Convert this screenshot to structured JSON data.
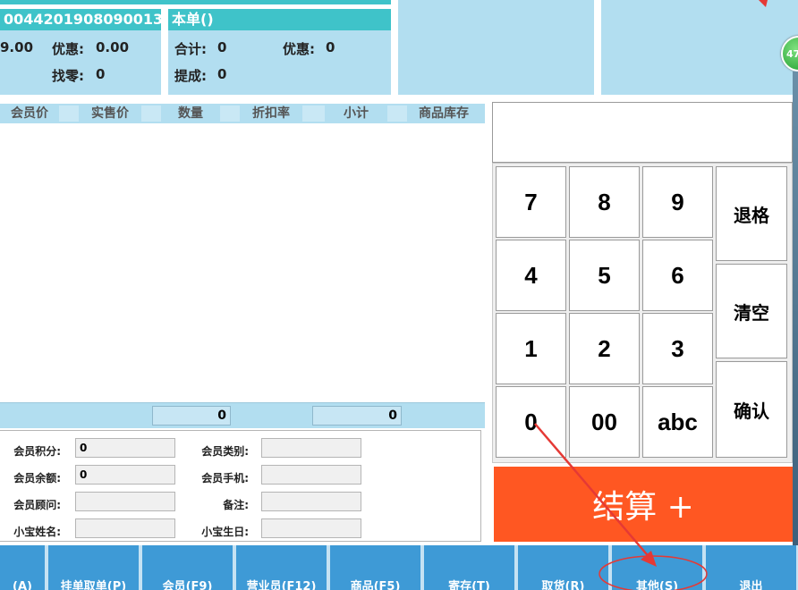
{
  "order_panel": {
    "title": "0044201908090013)",
    "received_value": "9.00",
    "discount_label": "优惠:",
    "discount_value": "0.00",
    "change_label": "找零:",
    "change_value": "0"
  },
  "current_panel": {
    "title": "本单()",
    "total_label": "合计:",
    "total_value": "0",
    "discount_label": "优惠:",
    "discount_value": "0",
    "commission_label": "提成:",
    "commission_value": "0"
  },
  "table": {
    "headers": [
      "会员价",
      "实售价",
      "数量",
      "折扣率",
      "小计",
      "商品库存"
    ],
    "totals": [
      "0",
      "0"
    ]
  },
  "keypad": {
    "keys": [
      "7",
      "8",
      "9",
      "4",
      "5",
      "6",
      "1",
      "2",
      "3",
      "0",
      "00",
      "abc"
    ],
    "backspace": "退格",
    "clear": "清空",
    "confirm": "确认",
    "checkout": "结算 +"
  },
  "member": {
    "points_label": "会员积分:",
    "points_value": "0",
    "type_label": "会员类别:",
    "type_value": "",
    "balance_label": "会员余额:",
    "balance_value": "0",
    "phone_label": "会员手机:",
    "phone_value": "",
    "advisor_label": "会员顾问:",
    "advisor_value": "",
    "note_label": "备注:",
    "note_value": "",
    "baby_name_label": "小宝姓名:",
    "baby_name_value": "",
    "baby_birthday_label": "小宝生日:",
    "baby_birthday_value": ""
  },
  "badge": {
    "text": "47"
  },
  "bottom_bar": [
    "(A)",
    "挂单取单(P)",
    "会员(F9)",
    "营业员(F12)",
    "商品(F5)",
    "寄存(T)",
    "取货(R)",
    "其他(S)",
    "退出"
  ],
  "colors": {
    "accent": "#3fc3c9",
    "panel": "#b2def0",
    "checkout": "#ff5722",
    "bottom_bar": "#3e9ad6",
    "annotation": "#e53935"
  }
}
